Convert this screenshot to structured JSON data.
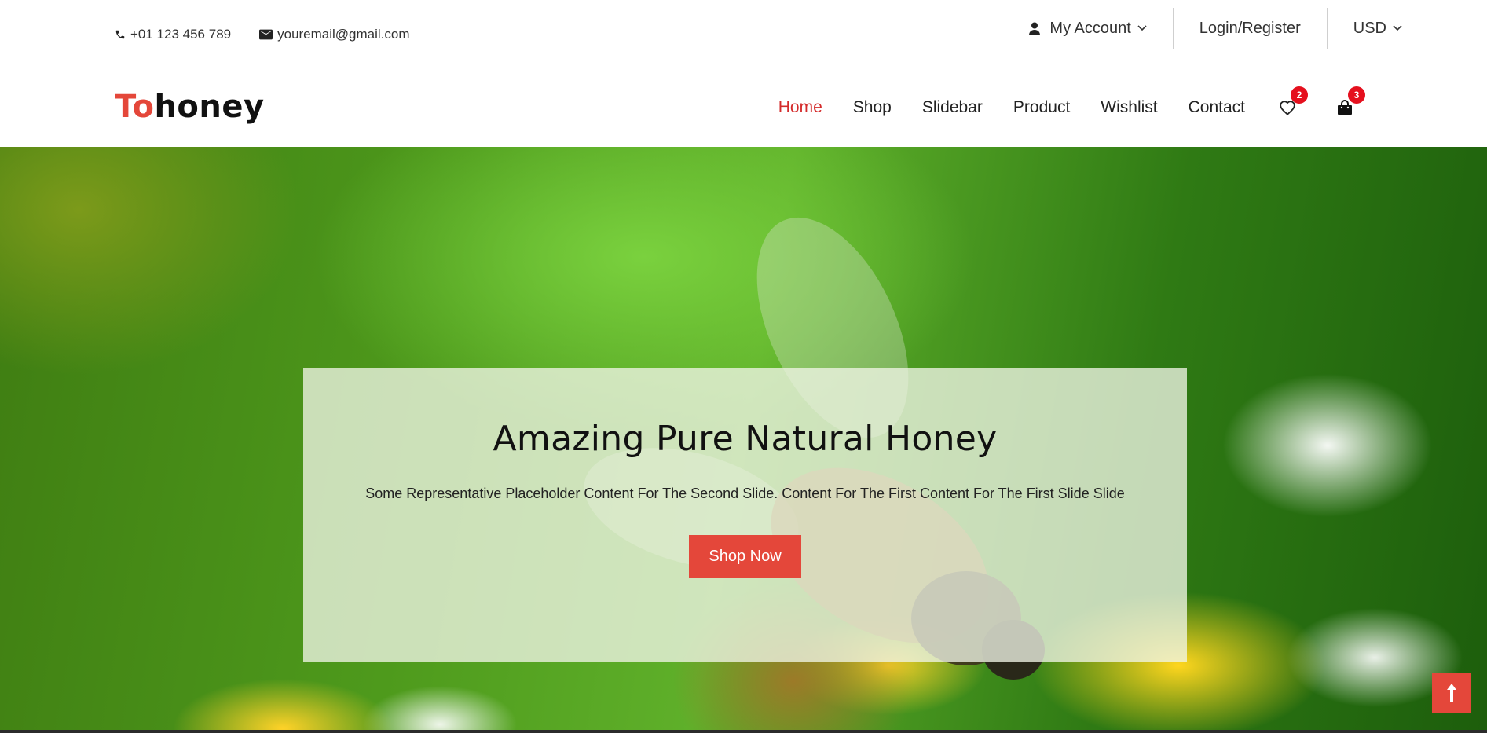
{
  "topbar": {
    "phone": "+01 123 456 789",
    "email": "youremail@gmail.com",
    "account_label": "My Account",
    "login_label": "Login/Register",
    "currency_label": "USD"
  },
  "header": {
    "logo_prefix": "To",
    "logo_suffix": "honey",
    "nav": [
      "Home",
      "Shop",
      "Slidebar",
      "Product",
      "Wishlist",
      "Contact"
    ],
    "active_nav": "Home",
    "wishlist_count": "2",
    "cart_count": "3"
  },
  "hero": {
    "title": "Amazing Pure Natural Honey",
    "description": "Some Representative Placeholder Content For The Second Slide. Content For The First Content For The First Slide Slide",
    "button_label": "Shop Now"
  },
  "colors": {
    "accent": "#e4473a",
    "active_nav": "#d42b2b",
    "badge": "#e5101e"
  },
  "icons": {
    "phone": "phone-icon",
    "email": "envelope-icon",
    "account": "user-icon",
    "wishlist": "heart-icon",
    "cart": "shopping-bag-icon",
    "scroll_top": "arrow-up-icon"
  }
}
